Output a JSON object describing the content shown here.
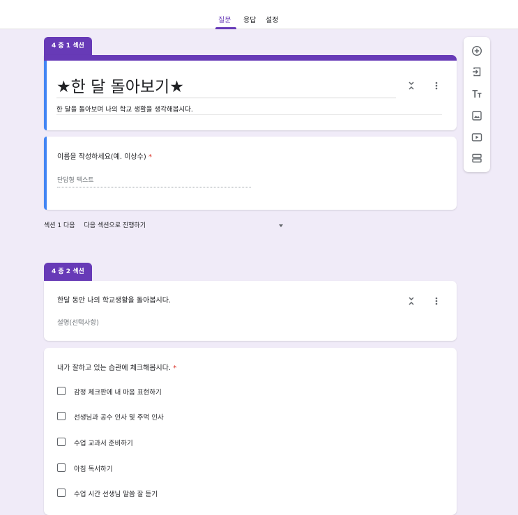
{
  "tabs": [
    {
      "label": "질문",
      "active": true
    },
    {
      "label": "응답",
      "active": false
    },
    {
      "label": "설정",
      "active": false
    }
  ],
  "section1": {
    "badge": "4 중 1 섹션",
    "title": "★한 달 돌아보기★",
    "description": "한 달을 돌아보며 나의 학교 생활을 생각해봅시다."
  },
  "question1": {
    "label": "이름을 작성하세요(예. 이상수)",
    "required_mark": "*",
    "placeholder": "단답형 텍스트"
  },
  "section_nav": {
    "label": "섹션 1 다음",
    "value": "다음 섹션으로 진행하기"
  },
  "section2": {
    "badge": "4 중 2 섹션",
    "title": "한달 동안 나의 학교생활을 돌아봅시다.",
    "description_placeholder": "설명(선택사항)"
  },
  "question2": {
    "label": "내가 잘하고 있는 습관에 체크해봅시다.",
    "required_mark": "*",
    "options": [
      "감정 체크판에 내 마음 표현하기",
      "선생님과 공수 인사 및 주먹 인사",
      "수업 교과서 준비하기",
      "아침 독서하기",
      "수업 시간 선생님 말씀 잘 듣기"
    ]
  },
  "toolbar": {
    "icons": [
      "add-question-icon",
      "import-questions-icon",
      "add-title-icon",
      "add-image-icon",
      "add-video-icon",
      "add-section-icon"
    ]
  },
  "colors": {
    "accent": "#673ab7",
    "background": "#f0ebf8",
    "focus_bar": "#4285f4",
    "required": "#d93025"
  }
}
